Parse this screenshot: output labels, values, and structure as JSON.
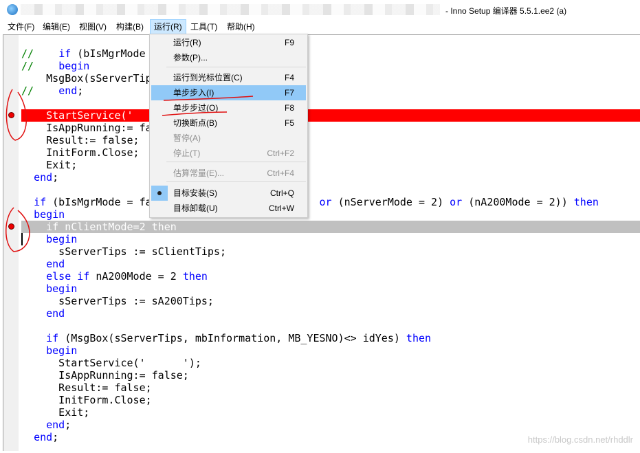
{
  "window": {
    "title": "- Inno Setup 编译器 5.5.1.ee2 (a)",
    "icon": "inno-setup-icon"
  },
  "menubar": [
    {
      "label": "文件(F)"
    },
    {
      "label": "编辑(E)"
    },
    {
      "label": "视图(V)"
    },
    {
      "label": "构建(B)"
    },
    {
      "label": "运行(R)",
      "active": true
    },
    {
      "label": "工具(T)"
    },
    {
      "label": "帮助(H)"
    }
  ],
  "run_menu": {
    "items": [
      {
        "label": "运行(R)",
        "shortcut": "F9"
      },
      {
        "label": "参数(P)...",
        "shortcut": ""
      },
      {
        "label": "运行到光标位置(C)",
        "shortcut": "F4"
      },
      {
        "label": "单步步入(I)",
        "shortcut": "F7",
        "highlighted": true
      },
      {
        "label": "单步步过(O)",
        "shortcut": "F8"
      },
      {
        "label": "切换断点(B)",
        "shortcut": "F5"
      },
      {
        "label": "暂停(A)",
        "shortcut": "",
        "disabled": true
      },
      {
        "label": "停止(T)",
        "shortcut": "Ctrl+F2",
        "disabled": true
      },
      {
        "label": "估算常量(E)...",
        "shortcut": "Ctrl+F4",
        "disabled": true
      },
      {
        "label": "目标安装(S)",
        "shortcut": "Ctrl+Q",
        "checked": true
      },
      {
        "label": "目标卸载(U)",
        "shortcut": "Ctrl+W"
      }
    ]
  },
  "code": {
    "lines": [
      [],
      [
        [
          "//",
          "cm"
        ],
        [
          "    ",
          ""
        ],
        [
          "if",
          "kw"
        ],
        [
          " (bIsMgrMode",
          ""
        ]
      ],
      [
        [
          "//",
          "cm"
        ],
        [
          "    ",
          ""
        ],
        [
          "begin",
          "kw"
        ]
      ],
      [
        [
          "    MsgBox(sServerTips",
          ""
        ]
      ],
      [
        [
          "//",
          "cm"
        ],
        [
          "    ",
          ""
        ],
        [
          "end",
          "kw"
        ],
        [
          ";",
          ""
        ]
      ],
      [],
      [
        [
          "    StartService('",
          ""
        ]
      ],
      [
        [
          "    IsAppRunning:= fa",
          ""
        ]
      ],
      [
        [
          "    Result:= false;",
          ""
        ]
      ],
      [
        [
          "    InitForm.Close;",
          ""
        ]
      ],
      [
        [
          "    Exit;",
          ""
        ]
      ],
      [
        [
          "  ",
          ""
        ],
        [
          "end",
          "kw"
        ],
        [
          ";",
          ""
        ]
      ],
      [],
      [
        [
          "  ",
          ""
        ],
        [
          "if",
          "kw"
        ],
        [
          " (bIsMgrMode = fa                           ",
          ""
        ],
        [
          "or",
          "kw"
        ],
        [
          " (nServerMode = 2) ",
          ""
        ],
        [
          "or",
          "kw"
        ],
        [
          " (nA200Mode = 2)) ",
          ""
        ],
        [
          "then",
          "kw"
        ]
      ],
      [
        [
          "  ",
          ""
        ],
        [
          "begin",
          "kw"
        ]
      ],
      [
        [
          "    if nClientMode=2 then",
          ""
        ]
      ],
      [
        [
          "    ",
          ""
        ],
        [
          "begin",
          "kw"
        ]
      ],
      [
        [
          "      sServerTips := sClientTips;",
          ""
        ]
      ],
      [
        [
          "    ",
          ""
        ],
        [
          "end",
          "kw"
        ]
      ],
      [
        [
          "    ",
          ""
        ],
        [
          "else",
          "kw"
        ],
        [
          " ",
          ""
        ],
        [
          "if",
          "kw"
        ],
        [
          " nA200Mode = 2 ",
          ""
        ],
        [
          "then",
          "kw"
        ]
      ],
      [
        [
          "    ",
          ""
        ],
        [
          "begin",
          "kw"
        ]
      ],
      [
        [
          "      sServerTips := sA200Tips;",
          ""
        ]
      ],
      [
        [
          "    ",
          ""
        ],
        [
          "end",
          "kw"
        ]
      ],
      [],
      [
        [
          "    ",
          ""
        ],
        [
          "if",
          "kw"
        ],
        [
          " (MsgBox(sServerTips, mbInformation, MB_YESNO)<> idYes) ",
          ""
        ],
        [
          "then",
          "kw"
        ]
      ],
      [
        [
          "    ",
          ""
        ],
        [
          "begin",
          "kw"
        ]
      ],
      [
        [
          "      StartService('      ');",
          ""
        ]
      ],
      [
        [
          "      IsAppRunning:= false;",
          ""
        ]
      ],
      [
        [
          "      Result:= false;",
          ""
        ]
      ],
      [
        [
          "      InitForm.Close;",
          ""
        ]
      ],
      [
        [
          "      Exit;",
          ""
        ]
      ],
      [
        [
          "    ",
          ""
        ],
        [
          "end",
          "kw"
        ],
        [
          ";",
          ""
        ]
      ],
      [
        [
          "  ",
          ""
        ],
        [
          "end",
          "kw"
        ],
        [
          ";",
          ""
        ]
      ]
    ],
    "breakpoint_lines": [
      7
    ],
    "current_line": 16
  },
  "watermark": "https://blog.csdn.net/rhddlr"
}
